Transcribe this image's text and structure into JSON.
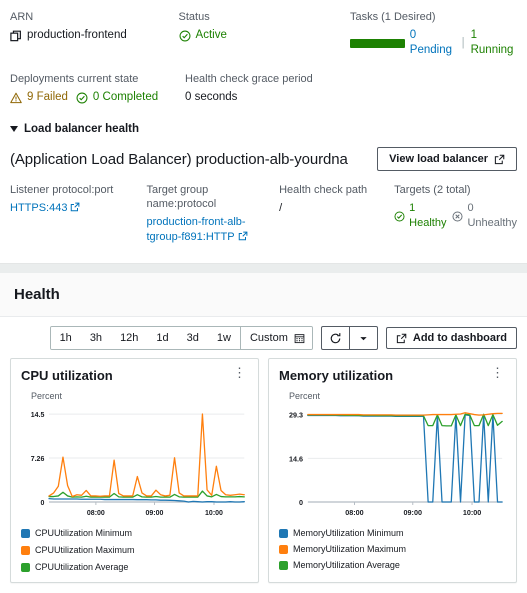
{
  "summary": {
    "arn": {
      "label": "ARN",
      "value": "production-frontend",
      "icon": "copy-icon"
    },
    "status": {
      "label": "Status",
      "value": "Active",
      "icon": "check-circle-icon",
      "color": "#1d8102"
    },
    "tasks": {
      "label": "Tasks (1 Desired)",
      "pending": "0 Pending",
      "running": "1 Running",
      "separator": "|",
      "bar_color": "#1d8102"
    },
    "deployments": {
      "label": "Deployments current state",
      "failed": "9 Failed",
      "completed": "0 Completed",
      "failed_icon": "warning-triangle-icon",
      "completed_icon": "check-circle-icon",
      "failed_color": "#906806",
      "completed_color": "#1d8102"
    },
    "grace": {
      "label": "Health check grace period",
      "value": "0 seconds"
    }
  },
  "load_balancer": {
    "expander_label": "Load balancer health",
    "title": "(Application Load Balancer) production-alb-yourdna",
    "view_button": "View load balancer",
    "fields": {
      "listener": {
        "label": "Listener protocol:port",
        "value": "HTTPS:443"
      },
      "target_group": {
        "label": "Target group name:protocol",
        "value": "production-front-alb-tgroup-f891:HTTP"
      },
      "health_path": {
        "label": "Health check path",
        "value": "/"
      },
      "targets": {
        "label": "Targets (2 total)",
        "healthy": "1 Healthy",
        "unhealthy": "0 Unhealthy",
        "healthy_color": "#1d8102",
        "unhealthy_color": "#687078"
      }
    }
  },
  "health": {
    "title": "Health",
    "ranges": [
      "1h",
      "3h",
      "12h",
      "1d",
      "3d",
      "1w"
    ],
    "custom_label": "Custom",
    "calendar_icon": "calendar-icon",
    "refresh_icon": "refresh-icon",
    "dropdown_icon": "chevron-down-icon",
    "add_to_dashboard": "Add to dashboard",
    "external_icon": "external-link-icon"
  },
  "chart_data": [
    {
      "type": "line",
      "title": "CPU utilization",
      "ylabel": "Percent",
      "xlabel": "",
      "ylim": [
        0,
        15.5
      ],
      "yticks": [
        0,
        7.26,
        14.5
      ],
      "ytick_labels": [
        "0",
        "7.26",
        "14.5"
      ],
      "xticks": [
        "08:00",
        "09:00",
        "10:00"
      ],
      "xtick_positions": [
        0.24,
        0.54,
        0.845
      ],
      "grid": true,
      "legend_position": "bottom",
      "series": [
        {
          "name": "CPUUtilization Minimum",
          "color": "#1f77b4",
          "values": [
            0.55,
            0.5,
            0.5,
            0.5,
            0.5,
            0.5,
            0.5,
            0.45,
            0.45,
            0.45,
            0.45,
            0.45,
            0.4,
            0.4,
            0.4,
            0.4,
            0.4,
            0.4,
            0.4,
            0.38,
            0.38,
            0.38,
            0.35,
            0.35,
            0.3,
            0.3,
            0.28,
            0.25,
            0.2,
            0.15,
            -0.35,
            0.1,
            0.05,
            -0.4,
            0.05,
            0.05,
            0.0,
            -0.45,
            -0.2,
            0.05,
            0.0,
            -0.45,
            0.05
          ]
        },
        {
          "name": "CPUUtilization Maximum",
          "color": "#ff7f0e",
          "values": [
            1.0,
            1.5,
            2.6,
            7.4,
            2.7,
            0.9,
            1.2,
            1.1,
            1.9,
            1.0,
            1.0,
            0.95,
            1.0,
            1.0,
            6.9,
            1.4,
            1.0,
            1.0,
            1.0,
            4.2,
            1.5,
            1.0,
            1.0,
            1.95,
            1.2,
            1.0,
            1.1,
            7.3,
            1.5,
            1.0,
            1.0,
            1.0,
            1.0,
            14.5,
            2.0,
            1.1,
            5.9,
            1.9,
            1.2,
            1.1,
            1.2,
            1.3,
            1.2
          ]
        },
        {
          "name": "CPUUtilization Average",
          "color": "#2ca02c",
          "values": [
            0.9,
            0.9,
            1.0,
            1.6,
            1.0,
            0.8,
            0.85,
            0.8,
            0.95,
            0.8,
            0.8,
            0.8,
            0.8,
            0.8,
            1.4,
            0.85,
            0.8,
            0.8,
            0.8,
            1.2,
            0.85,
            0.8,
            0.8,
            0.9,
            0.8,
            0.8,
            0.8,
            1.25,
            0.85,
            0.8,
            0.8,
            0.8,
            0.8,
            1.8,
            1.0,
            0.85,
            1.25,
            0.9,
            0.85,
            0.85,
            0.85,
            0.9,
            0.85
          ]
        }
      ]
    },
    {
      "type": "line",
      "title": "Memory utilization",
      "ylabel": "Percent",
      "xlabel": "",
      "ylim": [
        0,
        31.5
      ],
      "yticks": [
        0,
        14.6,
        29.3
      ],
      "ytick_labels": [
        "0",
        "14.6",
        "29.3"
      ],
      "xticks": [
        "08:00",
        "09:00",
        "10:00"
      ],
      "xtick_positions": [
        0.24,
        0.54,
        0.845
      ],
      "grid": true,
      "legend_position": "bottom",
      "series": [
        {
          "name": "MemoryUtilization Minimum",
          "color": "#1f77b4",
          "values": [
            29.0,
            29.0,
            29.0,
            29.0,
            29.0,
            29.0,
            29.0,
            28.9,
            28.9,
            28.9,
            28.9,
            28.9,
            28.8,
            28.8,
            28.8,
            28.8,
            28.8,
            28.8,
            28.8,
            28.7,
            28.7,
            28.7,
            28.7,
            28.7,
            28.7,
            28.7,
            0.0,
            0.0,
            29.0,
            0.0,
            0.0,
            0.0,
            29.1,
            0.0,
            29.2,
            29.0,
            0.0,
            0.0,
            29.3,
            0.0,
            29.2,
            0.0,
            0.0
          ]
        },
        {
          "name": "MemoryUtilization Maximum",
          "color": "#ff7f0e",
          "values": [
            29.3,
            29.3,
            29.3,
            29.3,
            29.3,
            29.3,
            29.3,
            29.3,
            29.3,
            29.3,
            29.3,
            29.3,
            29.2,
            29.2,
            29.2,
            29.2,
            29.2,
            29.2,
            29.2,
            29.1,
            29.1,
            29.1,
            29.1,
            29.1,
            29.1,
            29.1,
            29.2,
            29.3,
            29.3,
            29.3,
            29.3,
            29.3,
            29.4,
            29.5,
            29.9,
            29.6,
            29.3,
            29.1,
            29.2,
            29.4,
            29.6,
            29.7,
            29.7
          ]
        },
        {
          "name": "MemoryUtilization Average",
          "color": "#2ca02c",
          "values": [
            29.15,
            29.15,
            29.15,
            29.15,
            29.15,
            29.1,
            29.1,
            29.1,
            29.05,
            29.05,
            29.05,
            29.0,
            29.0,
            29.0,
            29.0,
            28.95,
            28.95,
            28.95,
            28.95,
            28.9,
            28.9,
            28.9,
            28.9,
            28.9,
            28.9,
            28.9,
            25.6,
            25.6,
            29.2,
            25.6,
            25.5,
            25.5,
            29.2,
            25.6,
            29.4,
            29.2,
            25.6,
            25.6,
            29.4,
            25.6,
            29.3,
            25.7,
            27.0
          ]
        }
      ]
    }
  ]
}
